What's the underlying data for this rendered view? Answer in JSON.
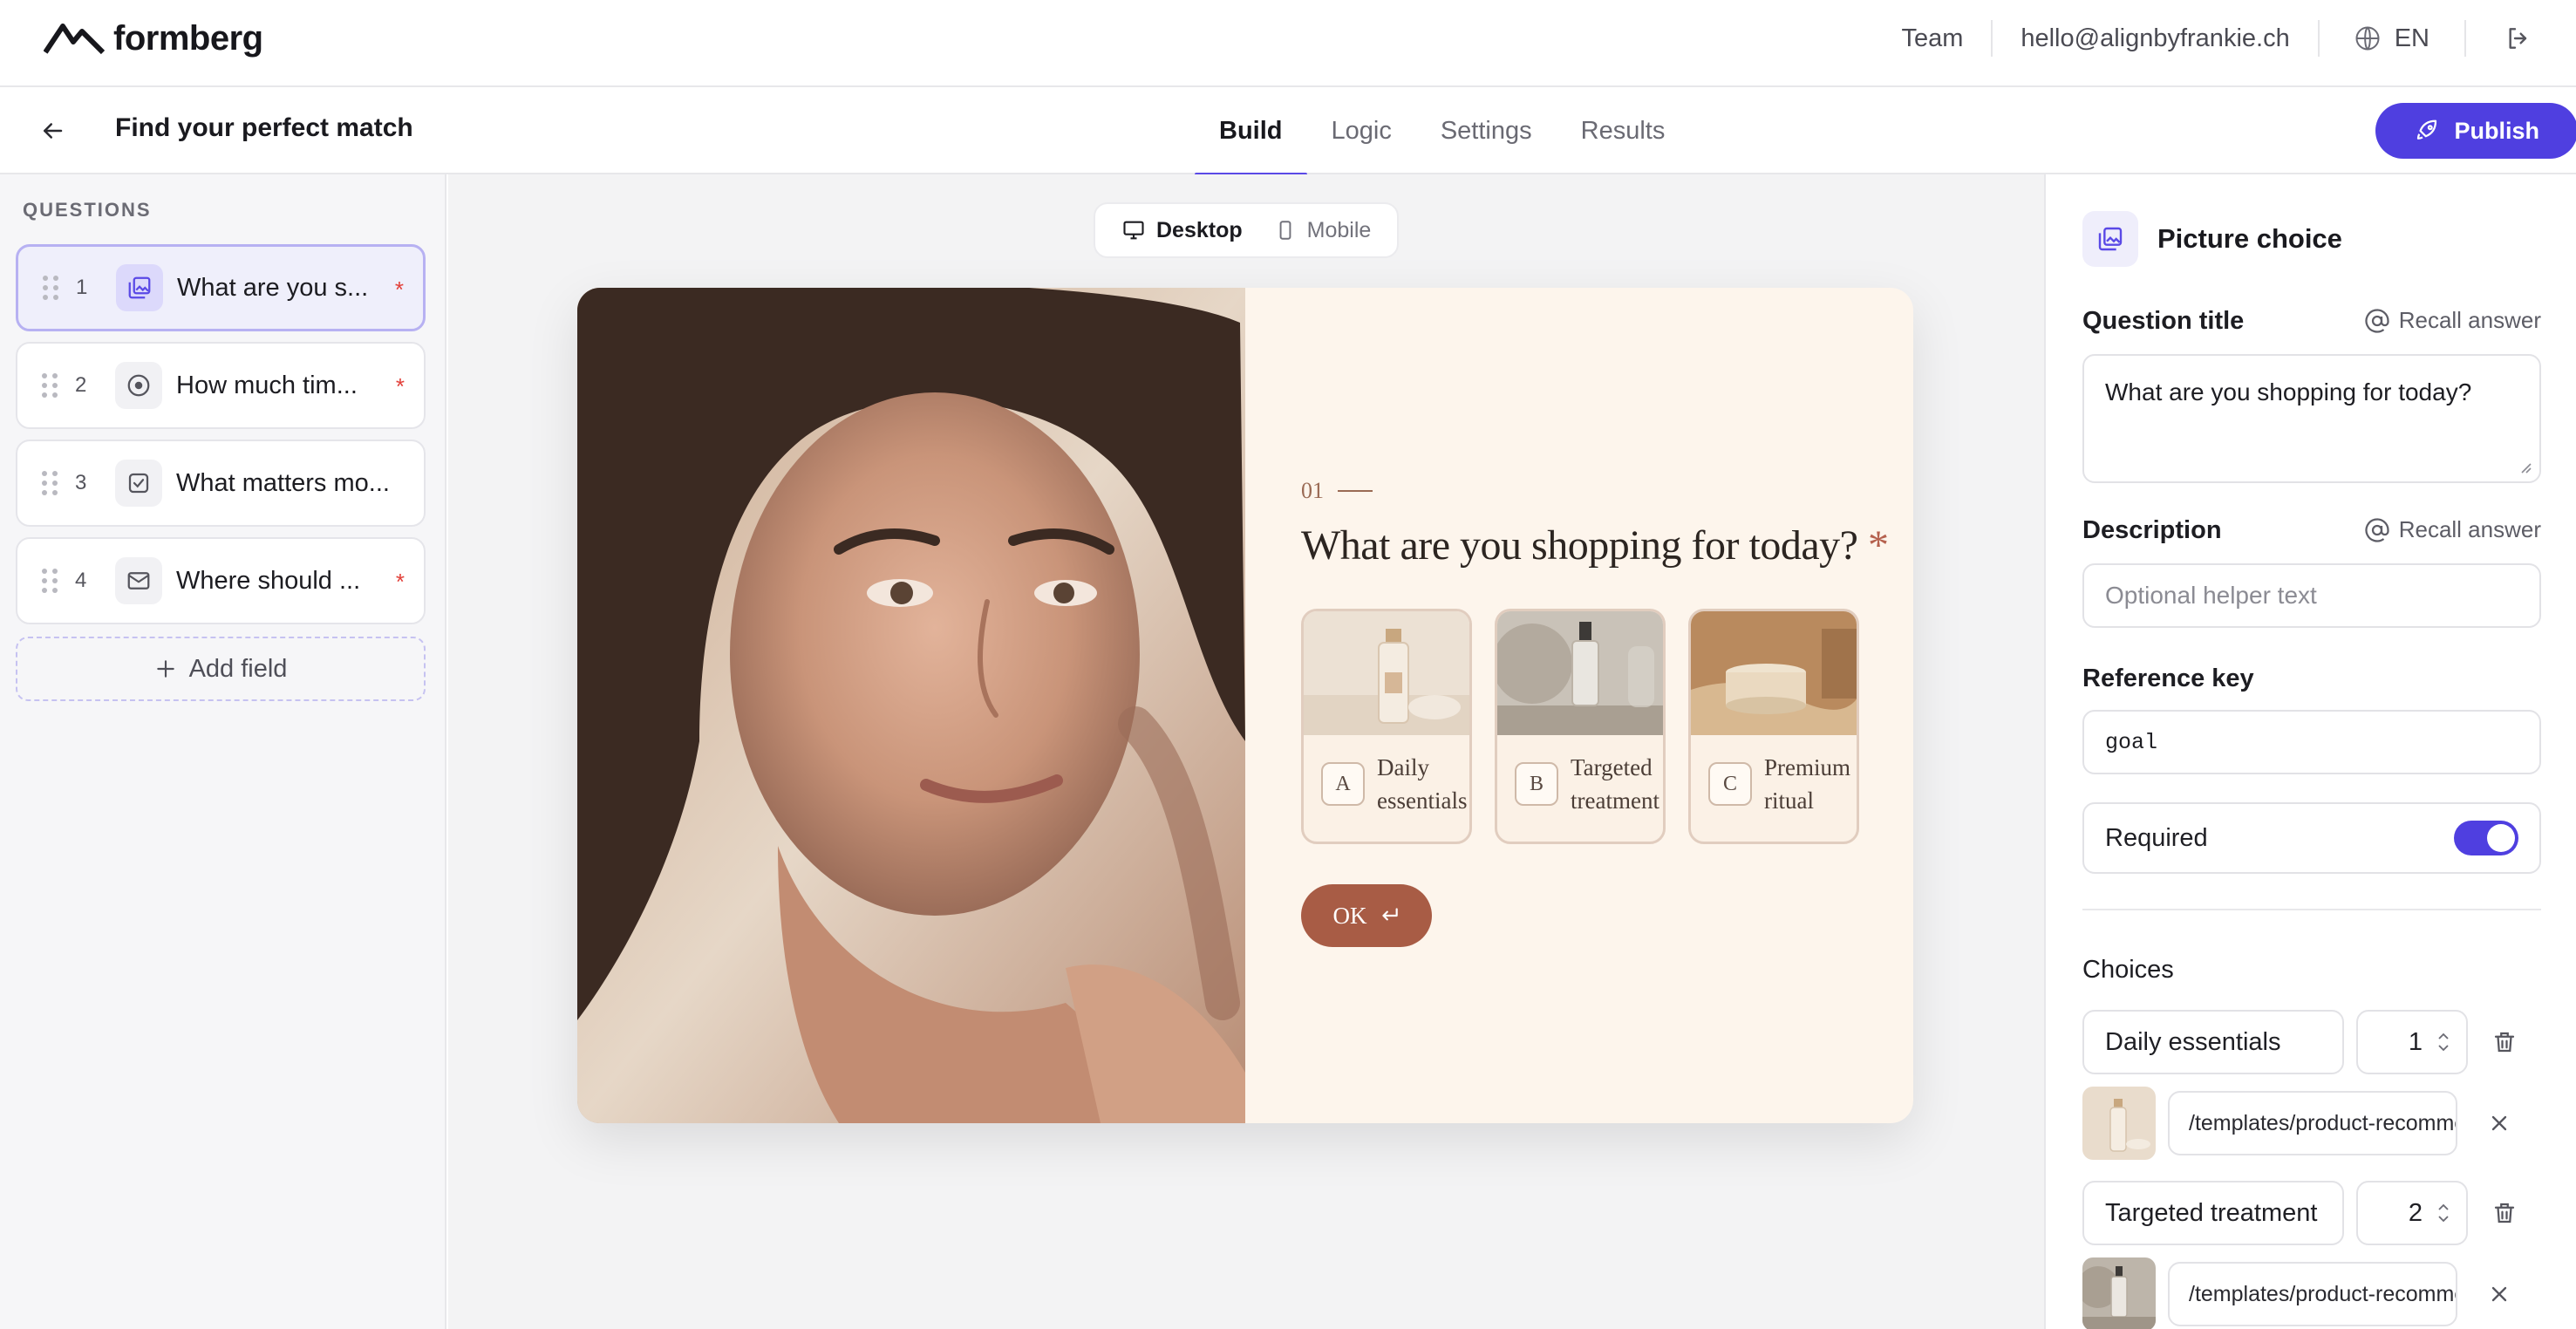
{
  "app": {
    "brand": "formberg",
    "nav": {
      "team": "Team",
      "email": "hello@alignbyfrankie.ch",
      "language": "EN"
    }
  },
  "form": {
    "title": "Find your perfect match",
    "tabs": [
      "Build",
      "Logic",
      "Settings",
      "Results"
    ],
    "active_tab": "Build",
    "publish_label": "Publish"
  },
  "sidebar": {
    "heading": "QUESTIONS",
    "questions": [
      {
        "num": "1",
        "label": "What are you s...",
        "icon": "picture-choice-icon",
        "required": "*"
      },
      {
        "num": "2",
        "label": "How much tim...",
        "icon": "radio-icon",
        "required": "*"
      },
      {
        "num": "3",
        "label": "What matters mo...",
        "icon": "checkbox-icon",
        "required": ""
      },
      {
        "num": "4",
        "label": "Where should ...",
        "icon": "mail-icon",
        "required": "*"
      }
    ],
    "add_field": "Add field"
  },
  "canvas": {
    "device_toggle": {
      "desktop": "Desktop",
      "mobile": "Mobile",
      "active": "Desktop"
    },
    "preview": {
      "question_number": "01",
      "question_title": "What are you shopping for today?",
      "required_mark": "*",
      "choices": [
        {
          "key": "A",
          "line1": "Daily",
          "line2": "essentials"
        },
        {
          "key": "B",
          "line1": "Targeted",
          "line2": "treatment"
        },
        {
          "key": "C",
          "line1": "Premium",
          "line2": "ritual"
        }
      ],
      "ok_label": "OK",
      "ok_icon": "enter-icon"
    }
  },
  "panel": {
    "type_label": "Picture choice",
    "question_title_label": "Question title",
    "recall_label": "Recall answer",
    "question_title_value": "What are you shopping for today?",
    "description_label": "Description",
    "description_placeholder": "Optional helper text",
    "reference_key_label": "Reference key",
    "reference_key_value": "goal",
    "required_label": "Required",
    "required_on": true,
    "choices_label": "Choices",
    "choices": [
      {
        "name": "Daily essentials",
        "score": "1",
        "image_path": "/templates/product-recommendation/daily-essentials.jpg"
      },
      {
        "name": "Targeted treatment",
        "score": "2",
        "image_path": "/templates/product-recommendation/targeted-treatment.jpg"
      }
    ]
  },
  "colors": {
    "accent": "#4f3fe0",
    "preview_bg": "#fdf5ec",
    "ok_button": "#a85c45",
    "required": "#e2403a"
  }
}
